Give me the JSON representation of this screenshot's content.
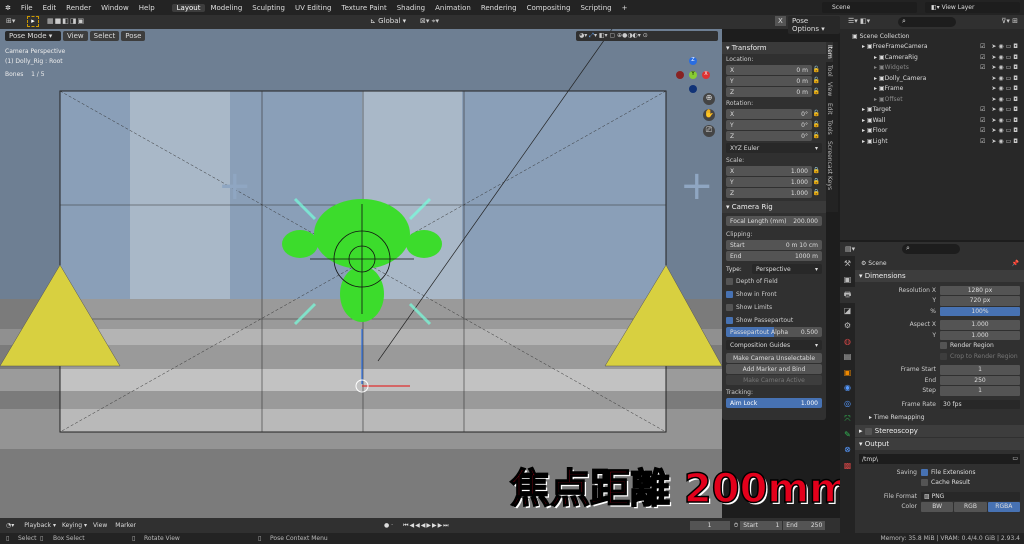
{
  "menubar": {
    "items": [
      "File",
      "Edit",
      "Render",
      "Window",
      "Help"
    ],
    "workspaces": [
      "Layout",
      "Modeling",
      "Sculpting",
      "UV Editing",
      "Texture Paint",
      "Shading",
      "Animation",
      "Rendering",
      "Compositing",
      "Scripting"
    ],
    "active_workspace": "Layout",
    "scene": "Scene",
    "view_layer": "View Layer"
  },
  "toolbar": {
    "orientation": "Global",
    "pose_options": "Pose Options",
    "x_mirror": "X"
  },
  "viewport": {
    "mode": "Pose Mode",
    "menus": [
      "View",
      "Select",
      "Pose"
    ],
    "info_line1": "Camera Perspective",
    "info_line2": "(1) Dolly_Rig : Root",
    "bones_label": "Bones",
    "bones_value": "1 / 5",
    "gizmo": {
      "x": "X",
      "y": "Y",
      "z": "Z"
    },
    "overlay_caption": "焦点距離 200mm"
  },
  "npanel": {
    "tabs": [
      "Item",
      "Tool",
      "View",
      "Edit",
      "Tools",
      "Screencast Keys"
    ],
    "transform": {
      "title": "Transform",
      "location_label": "Location:",
      "location": [
        {
          "axis": "X",
          "value": "0 m"
        },
        {
          "axis": "Y",
          "value": "0 m"
        },
        {
          "axis": "Z",
          "value": "0 m"
        }
      ],
      "rotation_label": "Rotation:",
      "rotation": [
        {
          "axis": "X",
          "value": "0°"
        },
        {
          "axis": "Y",
          "value": "0°"
        },
        {
          "axis": "Z",
          "value": "0°"
        }
      ],
      "rotation_mode": "XYZ Euler",
      "scale_label": "Scale:",
      "scale": [
        {
          "axis": "X",
          "value": "1.000"
        },
        {
          "axis": "Y",
          "value": "1.000"
        },
        {
          "axis": "Z",
          "value": "1.000"
        }
      ]
    },
    "camera_rig": {
      "title": "Camera Rig",
      "focal_label": "Focal Length (mm)",
      "focal_value": "200.000",
      "clipping_label": "Clipping:",
      "clip_start_label": "Start",
      "clip_start": "0 m 10 cm",
      "clip_end_label": "End",
      "clip_end": "1000 m",
      "type_label": "Type:",
      "type_value": "Perspective",
      "dof": "Depth of Field",
      "show_in_front": "Show in Front",
      "show_limits": "Show Limits",
      "show_passepartout": "Show Passepartout",
      "passepartout_label": "Passepartout Alpha",
      "passepartout_value": "0.500",
      "passepartout_fraction": 0.5,
      "composition_guides": "Composition Guides",
      "make_unselectable": "Make Camera Unselectable",
      "add_marker": "Add Marker and Bind",
      "make_active": "Make Camera Active",
      "tracking_label": "Tracking:",
      "aim_lock_label": "Aim Lock",
      "aim_lock_value": "1.000"
    }
  },
  "outliner": {
    "root": "Scene Collection",
    "items": [
      {
        "name": "FreeFrameCamera",
        "depth": 0,
        "check": true
      },
      {
        "name": "CameraRig",
        "depth": 1,
        "check": true
      },
      {
        "name": "Widgets",
        "depth": 1,
        "check": true,
        "dim": true
      },
      {
        "name": "Dolly_Camera",
        "depth": 1,
        "check": false
      },
      {
        "name": "Frame",
        "depth": 1,
        "check": false
      },
      {
        "name": "Offset",
        "depth": 1,
        "check": false,
        "dim": true
      },
      {
        "name": "Target",
        "depth": 0,
        "check": true
      },
      {
        "name": "Wall",
        "depth": 0,
        "check": true
      },
      {
        "name": "Floor",
        "depth": 0,
        "check": true
      },
      {
        "name": "Light",
        "depth": 0,
        "check": true
      }
    ]
  },
  "properties": {
    "context": "Scene",
    "dimensions_title": "Dimensions",
    "rows": [
      {
        "label": "Resolution X",
        "value": "1280 px"
      },
      {
        "label": "Y",
        "value": "720 px"
      },
      {
        "label": "%",
        "value": "100%",
        "highlight": true
      }
    ],
    "aspect": [
      {
        "label": "Aspect X",
        "value": "1.000"
      },
      {
        "label": "Y",
        "value": "1.000"
      }
    ],
    "render_region": "Render Region",
    "crop_region": "Crop to Render Region",
    "frames": [
      {
        "label": "Frame Start",
        "value": "1"
      },
      {
        "label": "End",
        "value": "250"
      },
      {
        "label": "Step",
        "value": "1"
      }
    ],
    "frame_rate_label": "Frame Rate",
    "frame_rate": "30 fps",
    "time_remapping": "Time Remapping",
    "stereoscopy": "Stereoscopy",
    "output_title": "Output",
    "output_path": "/tmp\\",
    "saving_label": "Saving",
    "file_extensions": "File Extensions",
    "cache_result": "Cache Result",
    "file_format_label": "File Format",
    "file_format": "PNG",
    "color_label": "Color",
    "color_options": [
      "BW",
      "RGB",
      "RGBA"
    ],
    "color_selected": "RGBA"
  },
  "timeline": {
    "menus": [
      "Playback",
      "Keying",
      "View",
      "Marker"
    ],
    "current_frame": "1",
    "start_label": "Start",
    "start": "1",
    "end_label": "End",
    "end": "250"
  },
  "status": {
    "select": "Select",
    "box_select": "Box Select",
    "rotate": "Rotate View",
    "context_menu": "Pose Context Menu",
    "memory": "Memory: 35.8 MiB | VRAM: 0.4/4.0 GiB | 2.93.4"
  }
}
